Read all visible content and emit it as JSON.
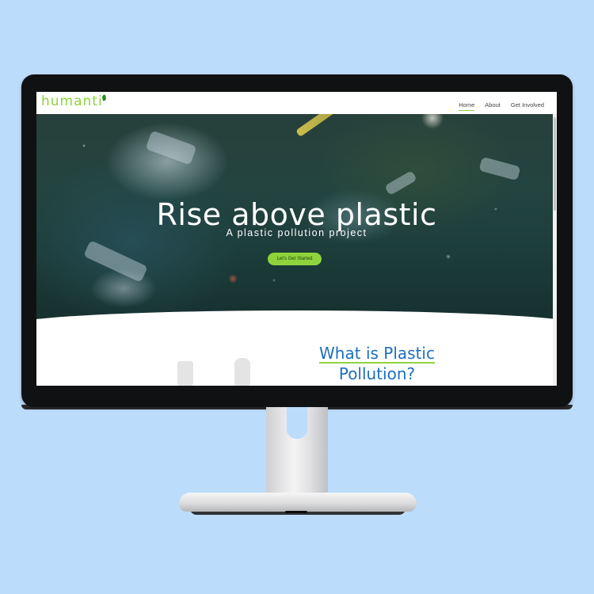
{
  "site": {
    "logo": "humanti",
    "nav": {
      "links": [
        "Home",
        "About",
        "Get Involved"
      ],
      "active": "Home"
    }
  },
  "hero": {
    "title": "Rise above plastic",
    "subtitle": "A plastic pollution project",
    "cta_label": "Let's Get Started"
  },
  "section": {
    "title_line1": "What is Plastic",
    "title_line2": "Pollution?"
  },
  "colors": {
    "accent_green": "#8ed33b",
    "heading_blue": "#1d6fc0",
    "background": "#bcdcfb"
  }
}
